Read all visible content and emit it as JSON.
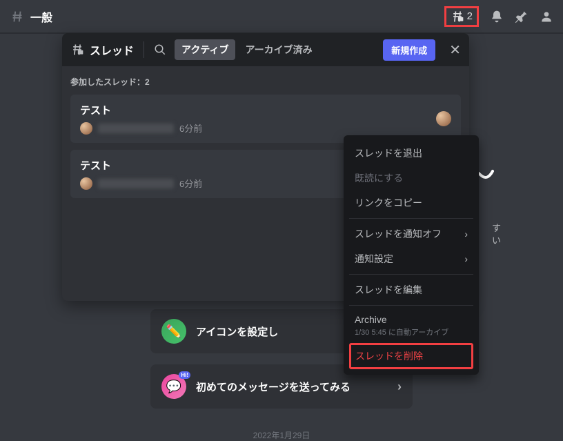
{
  "topbar": {
    "channel_name": "一般",
    "thread_count": "2"
  },
  "threads_panel": {
    "title": "スレッド",
    "tabs": {
      "active": "アクティブ",
      "archived": "アーカイブ済み"
    },
    "create_label": "新規作成",
    "section_label": "参加したスレッド：2",
    "items": [
      {
        "name": "テスト",
        "timestamp": "6分前"
      },
      {
        "name": "テスト",
        "timestamp": "6分前"
      }
    ]
  },
  "context_menu": {
    "leave": "スレッドを退出",
    "mark_read": "既読にする",
    "copy_link": "リンクをコピー",
    "mute": "スレッドを通知オフ",
    "notif_settings": "通知設定",
    "edit": "スレッドを編集",
    "archive": "Archive",
    "archive_note": "1/30 5:45 に自動アーカイブ",
    "delete": "スレッドを削除"
  },
  "background": {
    "text_fragment1": "す",
    "text_fragment2": "い",
    "row1": "アイコンを設定し",
    "row2": "初めてのメッセージを送ってみる",
    "date": "2022年1月29日"
  }
}
